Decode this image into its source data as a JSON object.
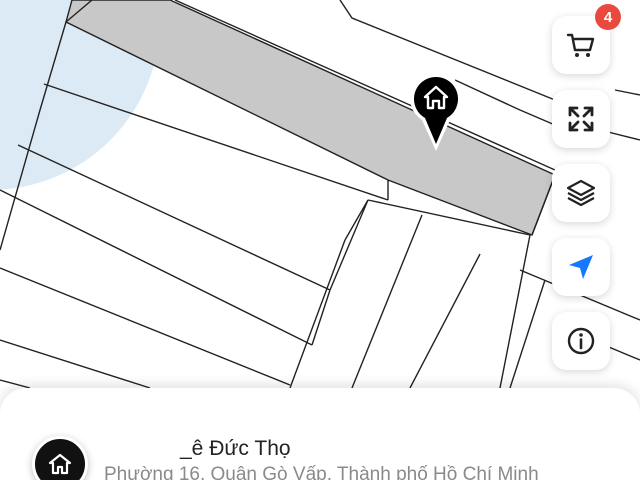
{
  "map": {
    "highlight_color": "#c8c8c8",
    "coverage_color": "#d6e6f4",
    "line_color": "#222222"
  },
  "controls": {
    "cart": {
      "icon": "cart-icon",
      "badge": "4",
      "badge_color": "#ea4a3d"
    },
    "fullscreen": {
      "icon": "expand-icon"
    },
    "layers": {
      "icon": "layers-icon"
    },
    "locate": {
      "icon": "navigation-arrow-icon",
      "color": "#1677ff"
    },
    "info": {
      "icon": "info-icon"
    }
  },
  "marker": {
    "icon": "home-icon"
  },
  "place": {
    "icon": "home-icon",
    "street": "_ê Đức Thọ",
    "address": "Phường 16, Quận Gò Vấp, Thành phố Hồ Chí Minh"
  }
}
